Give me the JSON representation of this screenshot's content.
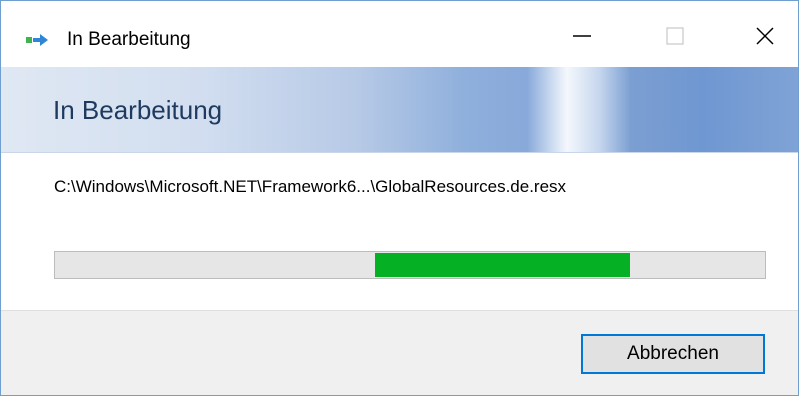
{
  "window": {
    "title": "In Bearbeitung",
    "controls": {
      "minimize": "minimize-icon",
      "maximize": "maximize-icon",
      "close": "close-icon"
    }
  },
  "header": {
    "title": "In Bearbeitung"
  },
  "operation": {
    "path": "C:\\Windows\\Microsoft.NET\\Framework6...\\GlobalResources.de.resx",
    "progress": {
      "style": "marquee",
      "fill_start": 0.45,
      "fill_end": 0.81,
      "fill_color": "#06b025"
    }
  },
  "footer": {
    "cancel_label": "Abbrechen"
  },
  "colors": {
    "accent": "#0078d7",
    "progress_green": "#06b025",
    "header_text": "#1f3a5f"
  }
}
